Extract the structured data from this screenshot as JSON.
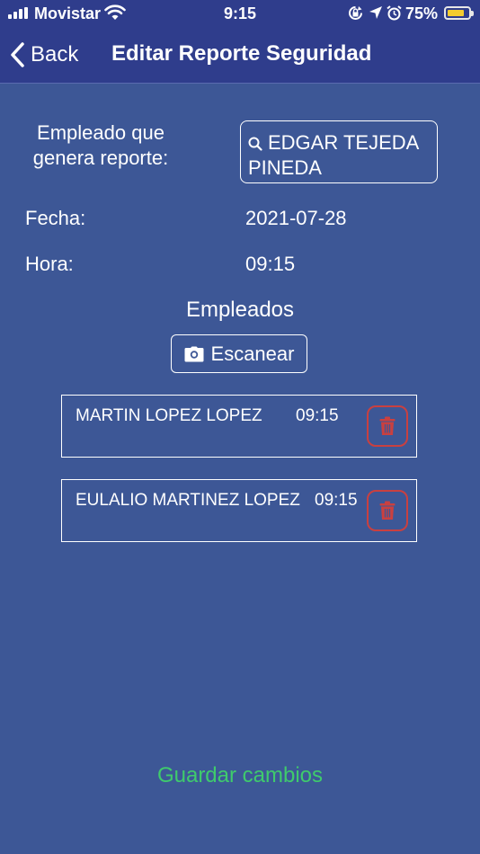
{
  "status_bar": {
    "carrier": "Movistar",
    "time": "9:15",
    "battery_percent": "75%",
    "battery_level": 0.75,
    "icons": [
      "signal-icon",
      "wifi-icon",
      "rotation-lock-icon",
      "location-icon",
      "alarm-icon",
      "battery-icon"
    ]
  },
  "nav": {
    "back_label": "Back",
    "title": "Editar Reporte Seguridad"
  },
  "form": {
    "employee_label": "Empleado que genera reporte:",
    "employee_value": "EDGAR TEJEDA PINEDA",
    "fecha_label": "Fecha:",
    "fecha_value": "2021-07-28",
    "hora_label": "Hora:",
    "hora_value": "09:15"
  },
  "employees_section": {
    "title": "Empleados",
    "scan_label": "Escanear",
    "items": [
      {
        "name": "MARTIN LOPEZ LOPEZ",
        "time": "09:15"
      },
      {
        "name": "EULALIO MARTINEZ LOPEZ",
        "time": "09:15"
      }
    ]
  },
  "footer": {
    "save_label": "Guardar cambios"
  },
  "colors": {
    "background": "#3d5796",
    "nav_bar": "#2f3d8c",
    "save_text": "#3fcb6c",
    "delete_accent": "#c94040",
    "battery_fill": "#f4cc2f"
  }
}
